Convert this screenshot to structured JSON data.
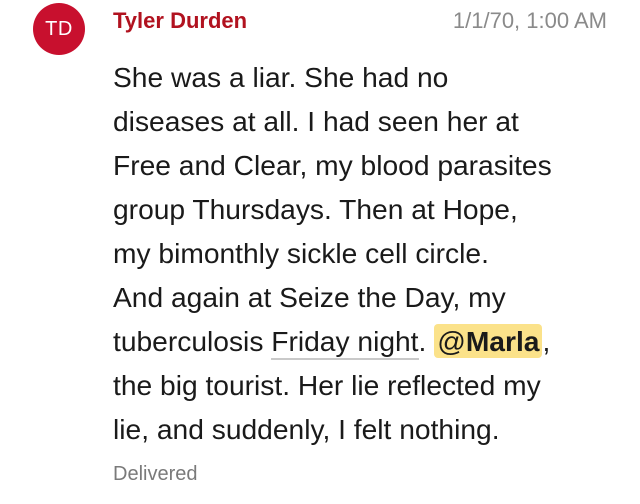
{
  "message": {
    "avatar_initials": "TD",
    "avatar_color": "#c8102e",
    "sender": "Tyler Durden",
    "sender_color": "#b1121f",
    "timestamp": "1/1/70, 1:00 AM",
    "lines": [
      "She was a liar. She had no",
      "diseases at all. I had seen her at",
      "Free and Clear, my blood parasites",
      "group Thursdays. Then at Hope,",
      "my bimonthly sickle cell circle.",
      "And again at Seize the Day, my"
    ],
    "line7_before": "tuberculosis ",
    "line7_link": "Friday night",
    "line7_middle": ". ",
    "mention_at": "@",
    "mention_name": "Marla",
    "line7_after": ",",
    "line8": "the big tourist. Her lie reflected my",
    "line9": "lie, and suddenly, I felt nothing.",
    "status": "Delivered",
    "mention_highlight_color": "#fbe28a"
  }
}
